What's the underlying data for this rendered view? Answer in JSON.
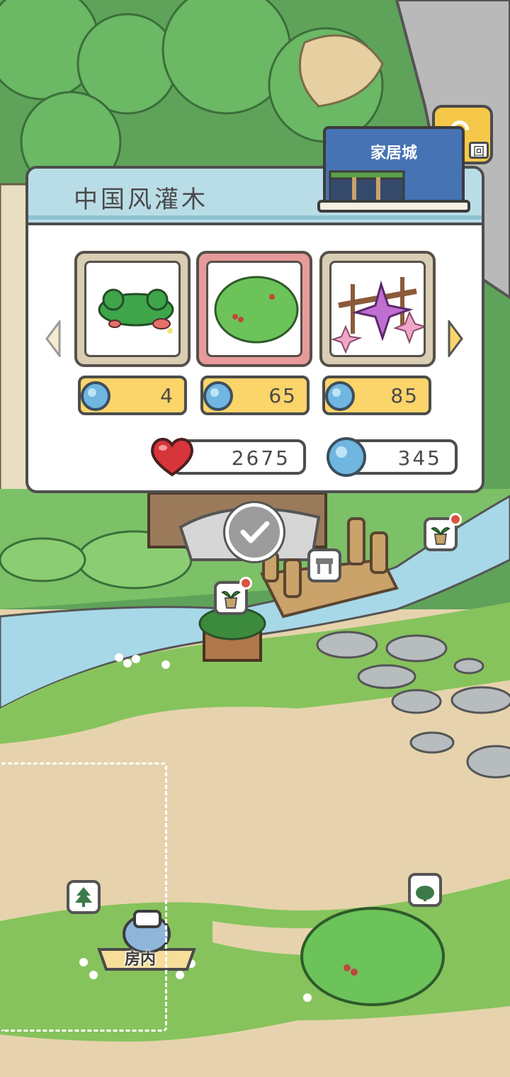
{
  "shop": {
    "category_title": "中国风灌木",
    "store_name": "家居城",
    "back_label": "回",
    "items": [
      {
        "name": "shrub-with-mushrooms",
        "price": "4",
        "selected": false
      },
      {
        "name": "cherry-bush",
        "price": "65",
        "selected": true
      },
      {
        "name": "lily-trellis",
        "price": "85",
        "selected": false
      }
    ]
  },
  "currency": {
    "hearts": "2675",
    "clovers": "345"
  },
  "map": {
    "room_label": "房内"
  },
  "colors": {
    "grass": "#5fa35a",
    "path": "#e6d3ad",
    "river": "#a7d8e8",
    "price_bg": "#fbd46a",
    "selected_card": "#e79a9a"
  }
}
